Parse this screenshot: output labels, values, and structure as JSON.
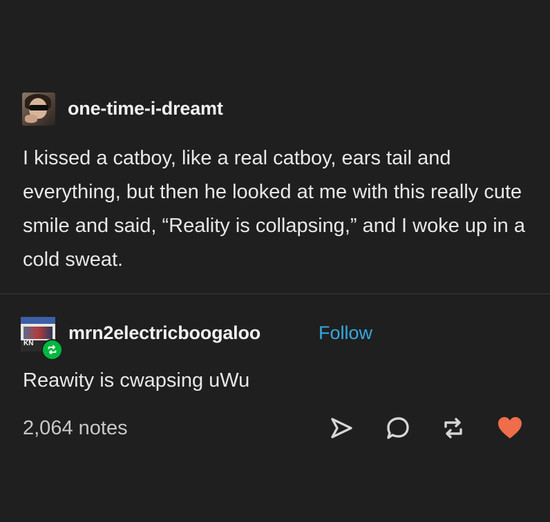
{
  "original_post": {
    "username": "one-time-i-dreamt",
    "avatar_icon": "avatar-woman-sunglasses",
    "body": "I kissed a catboy, like a real catboy, ears tail and everything, but then he looked at me with this really cute smile and said, “Reality is collapsing,” and I woke up in a cold sweat."
  },
  "reblog": {
    "username": "mrn2electricboogaloo",
    "avatar_icon": "avatar-magazine-cover",
    "avatar_text": "KN",
    "badge_icon": "reblog-icon",
    "follow_label": "Follow",
    "reply": "Reawity is cwapsing uWu"
  },
  "footer": {
    "notes": "2,064 notes",
    "actions": [
      "share-icon",
      "reply-icon",
      "reblog-icon",
      "like-icon"
    ]
  },
  "colors": {
    "background": "#1f1f1f",
    "text": "#e8e8e8",
    "follow": "#35a8e0",
    "reblog_badge": "#00b83f",
    "like": "#ef6d4a",
    "icons": "#d6d6d6"
  }
}
